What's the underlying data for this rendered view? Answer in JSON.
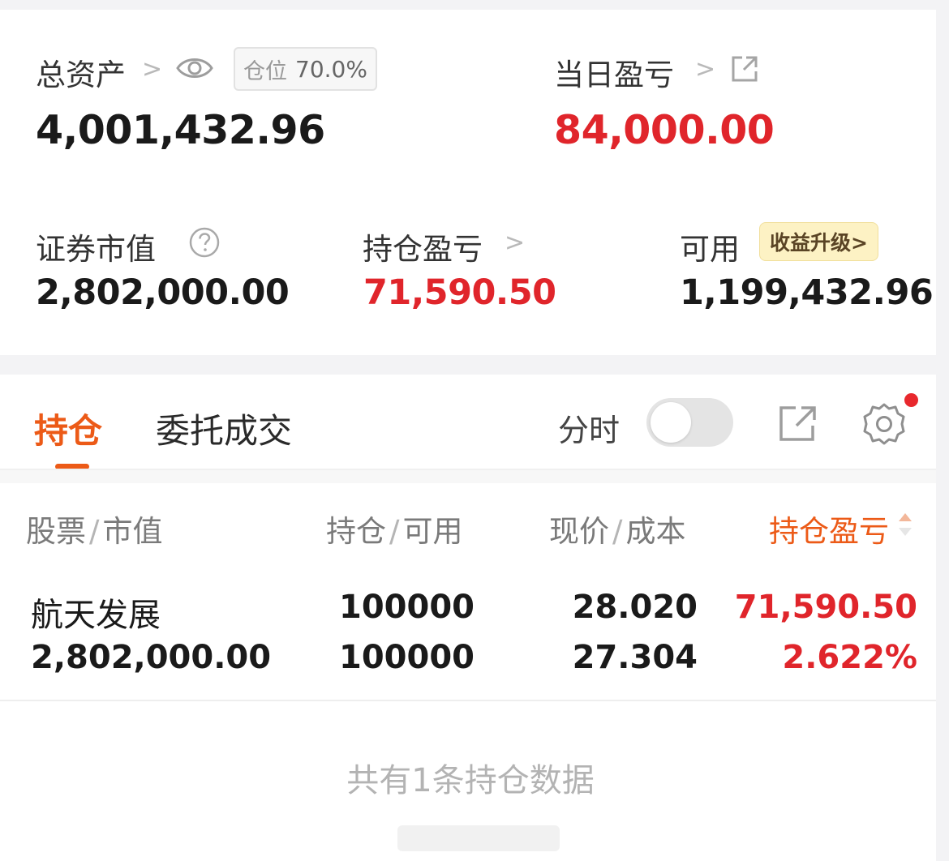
{
  "summary": {
    "total_assets": {
      "label": "总资产",
      "chevron": ">",
      "value": "4,001,432.96",
      "position_label": "仓位",
      "position_value": "70.0%"
    },
    "daily_pnl": {
      "label": "当日盈亏",
      "chevron": ">",
      "value": "84,000.00"
    },
    "market_value": {
      "label": "证券市值",
      "value": "2,802,000.00"
    },
    "position_pnl": {
      "label": "持仓盈亏",
      "chevron": ">",
      "value": "71,590.50"
    },
    "available": {
      "label": "可用",
      "badge": "收益升级>",
      "value": "1,199,432.96"
    }
  },
  "tabs": {
    "holdings": "持仓",
    "orders": "委托成交",
    "intraday_label": "分时",
    "intraday_on": false
  },
  "table": {
    "headers": {
      "stock": "股票",
      "market_value": "市值",
      "shares": "持仓",
      "available": "可用",
      "price": "现价",
      "cost": "成本",
      "pnl": "持仓盈亏",
      "sep": "/"
    },
    "rows": [
      {
        "name": "航天发展",
        "market_value": "2,802,000.00",
        "shares": "100000",
        "available": "100000",
        "price": "28.020",
        "cost": "27.304",
        "pnl": "71,590.50",
        "pnl_pct": "2.622%"
      }
    ],
    "footer": "共有1条持仓数据"
  },
  "icons": {
    "eye": "eye-icon",
    "share": "share-icon",
    "help": "help-circle-icon",
    "settings": "gear-icon",
    "sort": "sort-icon"
  },
  "colors": {
    "accent": "#ec5a17",
    "gain": "#e0252b",
    "badge_bg": "#fdf2c4"
  }
}
